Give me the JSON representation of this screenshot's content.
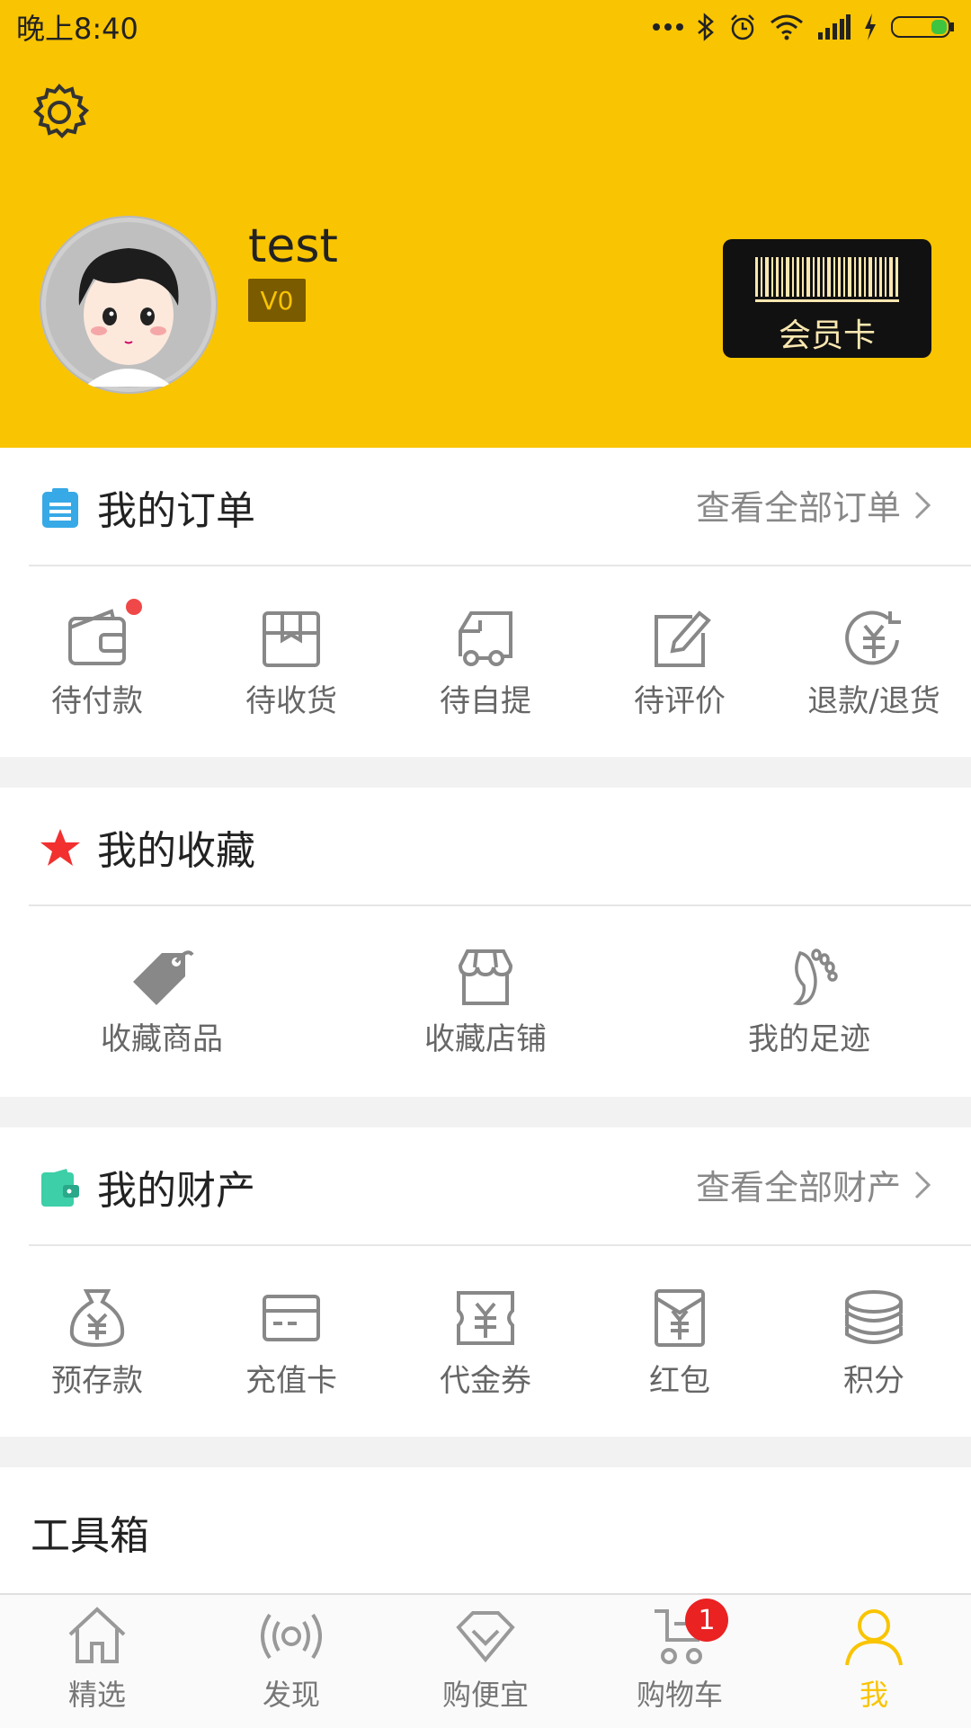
{
  "status_bar": {
    "time": "晚上8:40"
  },
  "profile": {
    "username": "test",
    "level": "V0",
    "member_card_label": "会员卡"
  },
  "orders": {
    "title": "我的订单",
    "view_all": "查看全部订单",
    "items": [
      {
        "label": "待付款",
        "icon": "wallet-icon"
      },
      {
        "label": "待收货",
        "icon": "package-icon"
      },
      {
        "label": "待自提",
        "icon": "delivery-truck-icon"
      },
      {
        "label": "待评价",
        "icon": "edit-review-icon"
      },
      {
        "label": "退款/退货",
        "icon": "refund-icon"
      }
    ]
  },
  "favorites": {
    "title": "我的收藏",
    "items": [
      {
        "label": "收藏商品",
        "icon": "tag-icon"
      },
      {
        "label": "收藏店铺",
        "icon": "shop-icon"
      },
      {
        "label": "我的足迹",
        "icon": "footprint-icon"
      }
    ]
  },
  "assets": {
    "title": "我的财产",
    "view_all": "查看全部财产",
    "items": [
      {
        "label": "预存款",
        "icon": "money-bag-icon"
      },
      {
        "label": "充值卡",
        "icon": "card-icon"
      },
      {
        "label": "代金券",
        "icon": "voucher-icon"
      },
      {
        "label": "红包",
        "icon": "red-envelope-icon"
      },
      {
        "label": "积分",
        "icon": "coins-icon"
      }
    ]
  },
  "toolbox": {
    "title": "工具箱"
  },
  "tabbar": {
    "items": [
      {
        "label": "精选",
        "icon": "home-icon"
      },
      {
        "label": "发现",
        "icon": "discover-icon"
      },
      {
        "label": "购便宜",
        "icon": "diamond-icon"
      },
      {
        "label": "购物车",
        "icon": "cart-icon"
      },
      {
        "label": "我",
        "icon": "user-icon"
      }
    ],
    "cart_badge": "1",
    "active_color": "#f9c401"
  },
  "colors": {
    "brand_yellow": "#f9c401",
    "badge_red": "#ea2222"
  }
}
